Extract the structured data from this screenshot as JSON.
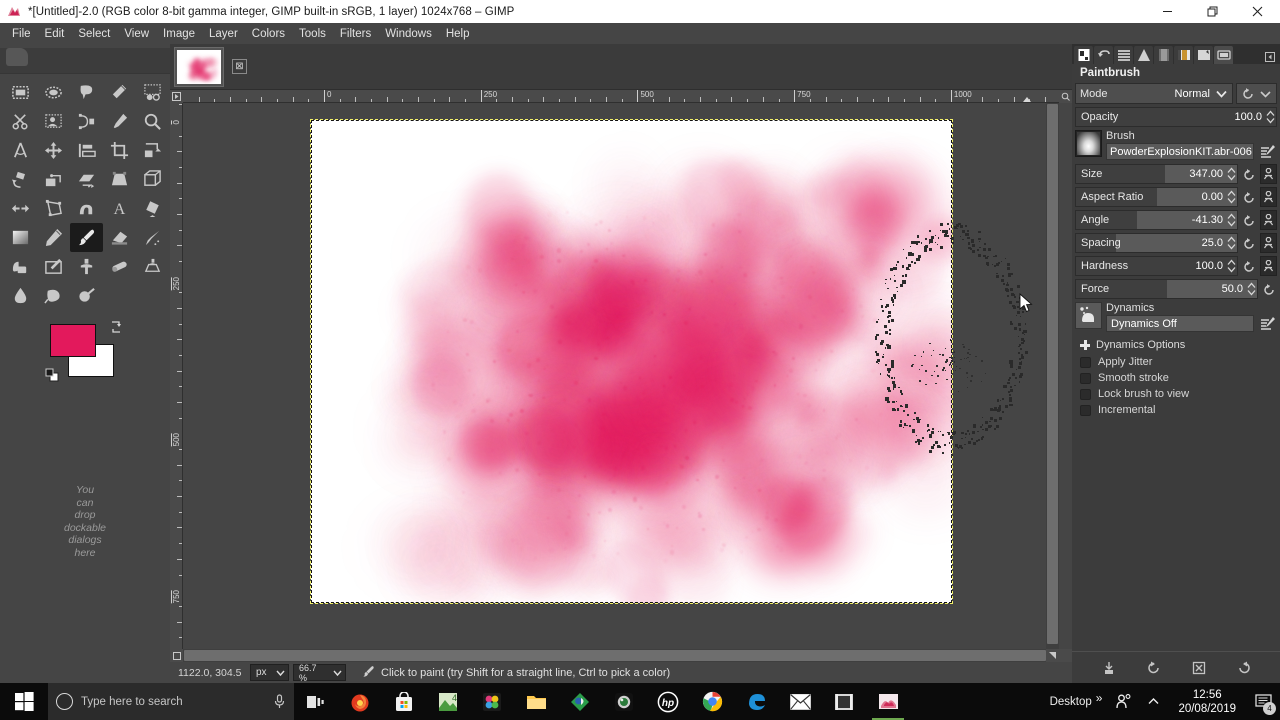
{
  "window": {
    "title": "*[Untitled]-2.0 (RGB color 8-bit gamma integer, GIMP built-in sRGB, 1 layer) 1024x768 – GIMP",
    "icon": "gimp-wilber-icon",
    "minimize": "–",
    "maximize": "❐",
    "close": "✕"
  },
  "menubar": {
    "items": [
      {
        "label": "File"
      },
      {
        "label": "Edit"
      },
      {
        "label": "Select"
      },
      {
        "label": "View"
      },
      {
        "label": "Image"
      },
      {
        "label": "Layer"
      },
      {
        "label": "Colors"
      },
      {
        "label": "Tools"
      },
      {
        "label": "Filters"
      },
      {
        "label": "Windows"
      },
      {
        "label": "Help"
      }
    ]
  },
  "toolbox": {
    "tools": [
      {
        "name": "rectangle-select-tool"
      },
      {
        "name": "ellipse-select-tool"
      },
      {
        "name": "free-select-tool"
      },
      {
        "name": "fuzzy-select-tool"
      },
      {
        "name": "select-by-color-tool"
      },
      {
        "name": "scissors-select-tool"
      },
      {
        "name": "foreground-select-tool"
      },
      {
        "name": "paths-tool"
      },
      {
        "name": "color-picker-tool"
      },
      {
        "name": "zoom-tool"
      },
      {
        "name": "measure-tool"
      },
      {
        "name": "move-tool"
      },
      {
        "name": "alignment-tool"
      },
      {
        "name": "crop-tool"
      },
      {
        "name": "unified-transform-tool"
      },
      {
        "name": "rotate-tool"
      },
      {
        "name": "scale-tool"
      },
      {
        "name": "shear-tool"
      },
      {
        "name": "perspective-tool"
      },
      {
        "name": "3d-transform-tool"
      },
      {
        "name": "flip-tool"
      },
      {
        "name": "cage-transform-tool"
      },
      {
        "name": "warp-transform-tool"
      },
      {
        "name": "text-tool"
      },
      {
        "name": "bucket-fill-tool"
      },
      {
        "name": "gradient-tool"
      },
      {
        "name": "pencil-tool"
      },
      {
        "name": "paintbrush-tool"
      },
      {
        "name": "eraser-tool"
      },
      {
        "name": "airbrush-tool"
      },
      {
        "name": "ink-tool"
      },
      {
        "name": "mypaint-brush-tool"
      },
      {
        "name": "clone-tool"
      },
      {
        "name": "heal-tool"
      },
      {
        "name": "perspective-clone-tool"
      },
      {
        "name": "blur-sharpen-tool"
      },
      {
        "name": "smudge-tool"
      },
      {
        "name": "dodge-burn-tool"
      }
    ],
    "selected_tool": "paintbrush-tool",
    "foreground_color": "#E3195C",
    "background_color": "#FFFFFF",
    "dock_hint": "You\ncan\ndrop\ndockable\ndialogs\nhere",
    "dock_hint_lines": [
      "You",
      "can",
      "drop",
      "dockable",
      "dialogs",
      "here"
    ]
  },
  "canvas": {
    "tab_close_label": "⊠",
    "ruler_h_labels": [
      "0",
      "250",
      "500",
      "750",
      "1000"
    ],
    "ruler_v_labels": [
      "0",
      "250",
      "500",
      "750"
    ],
    "image_size": "1024x768"
  },
  "statusbar": {
    "pointer_position": "1122.0, 304.5",
    "unit": "px",
    "zoom": "66.7 %",
    "message": "Click to paint (try Shift for a straight line, Ctrl to pick a color)",
    "message_icon": "paintbrush-icon"
  },
  "dock": {
    "tabs": [
      {
        "name": "tool-options-tab"
      },
      {
        "name": "undo-history-tab"
      },
      {
        "name": "layers-tab"
      },
      {
        "name": "channels-tab"
      },
      {
        "name": "paths-tab"
      },
      {
        "name": "gradients-tab"
      },
      {
        "name": "patterns-tab"
      },
      {
        "name": "tool-preset-tab"
      }
    ],
    "menu_icon": "tab-menu-icon",
    "tool_name": "Paintbrush",
    "mode": {
      "label": "Mode",
      "value": "Normal"
    },
    "sliders": [
      {
        "name": "Opacity",
        "value": "100.0",
        "fill": 100
      },
      {
        "name": "Size",
        "value": "347.00",
        "fill": 55
      },
      {
        "name": "Aspect Ratio",
        "value": "0.00",
        "fill": 50
      },
      {
        "name": "Angle",
        "value": "-41.30",
        "fill": 38
      },
      {
        "name": "Spacing",
        "value": "25.0",
        "fill": 25
      },
      {
        "name": "Hardness",
        "value": "100.0",
        "fill": 100
      },
      {
        "name": "Force",
        "value": "50.0",
        "fill": 50
      }
    ],
    "brush": {
      "caption": "Brush",
      "value": "PowderExplosionKIT.abr-006"
    },
    "dynamics": {
      "caption": "Dynamics",
      "value": "Dynamics Off"
    },
    "dynamics_options": "Dynamics Options",
    "checkboxes": [
      {
        "label": "Apply Jitter",
        "checked": false
      },
      {
        "label": "Smooth stroke",
        "checked": false
      },
      {
        "label": "Lock brush to view",
        "checked": false
      },
      {
        "label": "Incremental",
        "checked": false
      }
    ],
    "footer": [
      {
        "name": "save-tool-preset-button"
      },
      {
        "name": "restore-tool-preset-button"
      },
      {
        "name": "delete-tool-preset-button"
      },
      {
        "name": "reset-tool-options-button"
      }
    ]
  },
  "taskbar": {
    "start": "windows-start-icon",
    "search_placeholder": "Type here to search",
    "mic_icon": "microphone-icon",
    "buttons": [
      {
        "name": "task-view-icon"
      },
      {
        "name": "firefox-icon"
      },
      {
        "name": "microsoft-store-icon"
      },
      {
        "name": "photos-icon"
      },
      {
        "name": "app-colorful-icon"
      },
      {
        "name": "file-explorer-icon"
      },
      {
        "name": "green-diamond-app-icon"
      },
      {
        "name": "camera-app-icon"
      },
      {
        "name": "hp-icon"
      },
      {
        "name": "google-chrome-icon"
      },
      {
        "name": "microsoft-edge-icon"
      },
      {
        "name": "mail-icon"
      },
      {
        "name": "movie-maker-icon"
      },
      {
        "name": "gimp-icon"
      }
    ],
    "desktop_label": "Desktop",
    "overflow_chevron": "»",
    "people_icon": "people-icon",
    "show_hidden_icon": "show-hidden-icons-chevron",
    "time": "12:56",
    "date": "20/08/2019",
    "notification_count": "4"
  }
}
